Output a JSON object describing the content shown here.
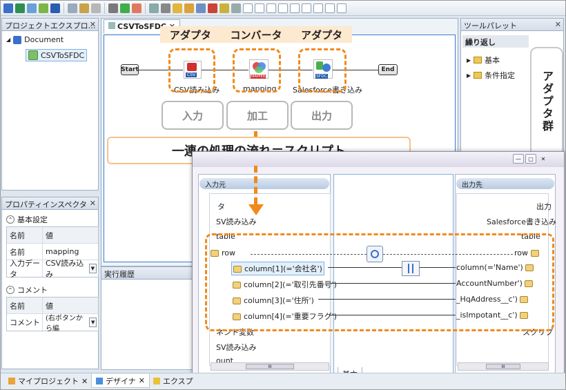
{
  "toolbar": {
    "icons": [
      "new-icon",
      "open-icon",
      "refresh-icon",
      "check-icon",
      "save-icon",
      "cut-icon",
      "copy-icon",
      "paste-icon",
      "debug-icon",
      "run-icon",
      "stop-icon",
      "grid-icon",
      "tool-icon",
      "folder-icon",
      "doc-icon",
      "info-icon",
      "export-icon",
      "bug-icon",
      "layout-icon"
    ]
  },
  "project_explorer": {
    "title": "プロジェクトエクスプロ…",
    "root": "Document",
    "child": "CSVToSFDC"
  },
  "property_inspector": {
    "title": "プロパティインスペクタ",
    "section_basic": "基本設定",
    "head_name": "名前",
    "head_value": "値",
    "rows": [
      {
        "k": "名前",
        "v": "mapping"
      },
      {
        "k": "入力データ",
        "v": "CSV読み込み"
      }
    ],
    "section_comment": "コメント",
    "comment_head_name": "名前",
    "comment_head_value": "値",
    "comment_row": {
      "k": "コメント",
      "v": "(右ボタンから編"
    }
  },
  "designer": {
    "tab": "CSVToSFDC",
    "start": "Start",
    "end": "End",
    "node1": "CSV読み込み",
    "node2": "mapping",
    "node3": "Salesforce書き込み",
    "csv_tag": "CSV",
    "mapper_tag": "MAPPER",
    "sfdc_tag": "SFDC"
  },
  "exec_history": {
    "title": "実行履歴"
  },
  "tool_palette": {
    "title": "ツールパレット",
    "sub": "繰り返し",
    "items": [
      "基本",
      "条件指定"
    ]
  },
  "annotations": {
    "adapter1": "アダプタ",
    "converter": "コンバータ",
    "adapter2": "アダプタ",
    "phase_input": "入力",
    "phase_process": "加工",
    "phase_output": "出力",
    "callout": "一連の処理の流れ＝スクリプト",
    "adapters_group": "アダプタ群"
  },
  "mapping_window": {
    "left_head": "入力元",
    "right_head": "出力先",
    "left_rows": [
      "タ",
      "SV読み込み",
      "table",
      "row",
      "column[1](='会社名')",
      "column[2](='取引先番号')",
      "column[3](='住所')",
      "column[4](='重要フラグ')",
      "ネント変数",
      "SV読み込み",
      "ount"
    ],
    "right_rows": [
      "出力",
      "Salesforce書き込み",
      "table",
      "row",
      "column(='Name')",
      "AccountNumber')",
      "_HqAddress__c')",
      "_isImpotant__c')",
      "スクリプ"
    ],
    "bottom_tab": "基本",
    "scroll_mark": "III"
  },
  "bottom_tabs": [
    "マイプロジェクト",
    "デザイナ",
    "エクスプ"
  ]
}
